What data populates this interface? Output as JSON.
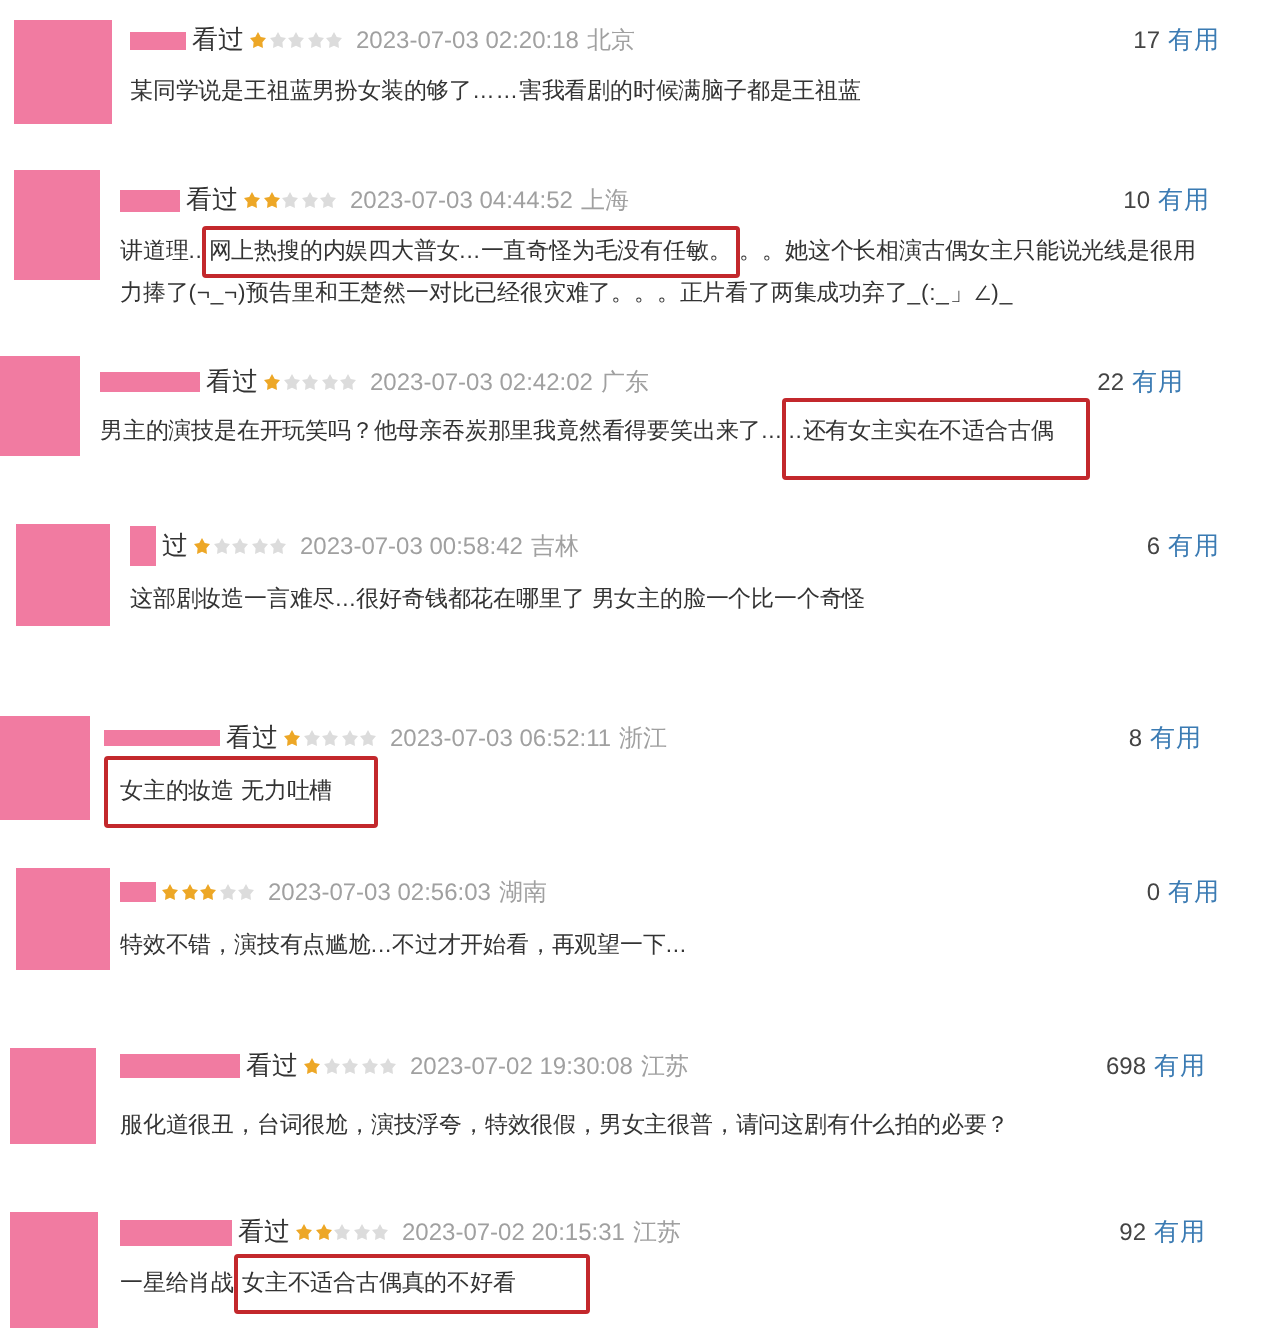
{
  "reviews": [
    {
      "status": "看过",
      "stars": 1,
      "time": "2023-07-03 02:20:18",
      "location": "北京",
      "votes": "17",
      "vote_label": "有用",
      "comment": [
        {
          "text": "某同学说是王祖蓝男扮女装的够了……害我看剧的时候满脑子都是王祖蓝",
          "highlighted": false
        }
      ]
    },
    {
      "status": "看过",
      "stars": 2,
      "time": "2023-07-03 04:44:52",
      "location": "上海",
      "votes": "10",
      "vote_label": "有用",
      "comment": [
        {
          "text": "讲道理..",
          "highlighted": false
        },
        {
          "text": "网上热搜的内娱四大普女...一直奇怪为毛没有任敏。",
          "highlighted": true
        },
        {
          "text": "。。她这个长相演古偶女主只能说光线是很用力捧了(¬_¬)预告里和王楚然一对比已经很灾难了。。。正片看了两集成功弃了_(:_」∠)_",
          "highlighted": false
        }
      ]
    },
    {
      "status": "看过",
      "stars": 1,
      "time": "2023-07-03 02:42:02",
      "location": "广东",
      "votes": "22",
      "vote_label": "有用",
      "comment": [
        {
          "text": "男主的演技是在开玩笑吗？他母亲吞炭那里我竟然看得要笑出来了...",
          "highlighted": false
        },
        {
          "text": "..还有女主实在不适合古偶",
          "highlighted": true
        }
      ]
    },
    {
      "status": "过",
      "stars": 1,
      "time": "2023-07-03 00:58:42",
      "location": "吉林",
      "votes": "6",
      "vote_label": "有用",
      "comment": [
        {
          "text": "这部剧妆造一言难尽...很好奇钱都花在哪里了 男女主的脸一个比一个奇怪",
          "highlighted": false
        }
      ]
    },
    {
      "status": "看过",
      "stars": 1,
      "time": "2023-07-03 06:52:11",
      "location": "浙江",
      "votes": "8",
      "vote_label": "有用",
      "comment": [
        {
          "text": "女主的妆造 无力吐槽",
          "highlighted": true
        }
      ]
    },
    {
      "stars": 3,
      "time": "2023-07-03 02:56:03",
      "location": "湖南",
      "votes": "0",
      "vote_label": "有用",
      "comment": [
        {
          "text": "特效不错，演技有点尴尬...不过才开始看，再观望一下...",
          "highlighted": false
        }
      ]
    },
    {
      "status": "看过",
      "stars": 1,
      "time": "2023-07-02 19:30:08",
      "location": "江苏",
      "votes": "698",
      "vote_label": "有用",
      "comment": [
        {
          "text": "服化道很丑，台词很尬，演技浮夸，特效很假，男女主很普，请问这剧有什么拍的必要？",
          "highlighted": false
        }
      ]
    },
    {
      "status": "看过",
      "stars": 2,
      "time": "2023-07-02 20:15:31",
      "location": "江苏",
      "votes": "92",
      "vote_label": "有用",
      "comment": [
        {
          "text": "一星给肖战",
          "highlighted": false
        },
        {
          "text": "女主不适合古偶真的不好看",
          "highlighted": true
        }
      ]
    }
  ]
}
